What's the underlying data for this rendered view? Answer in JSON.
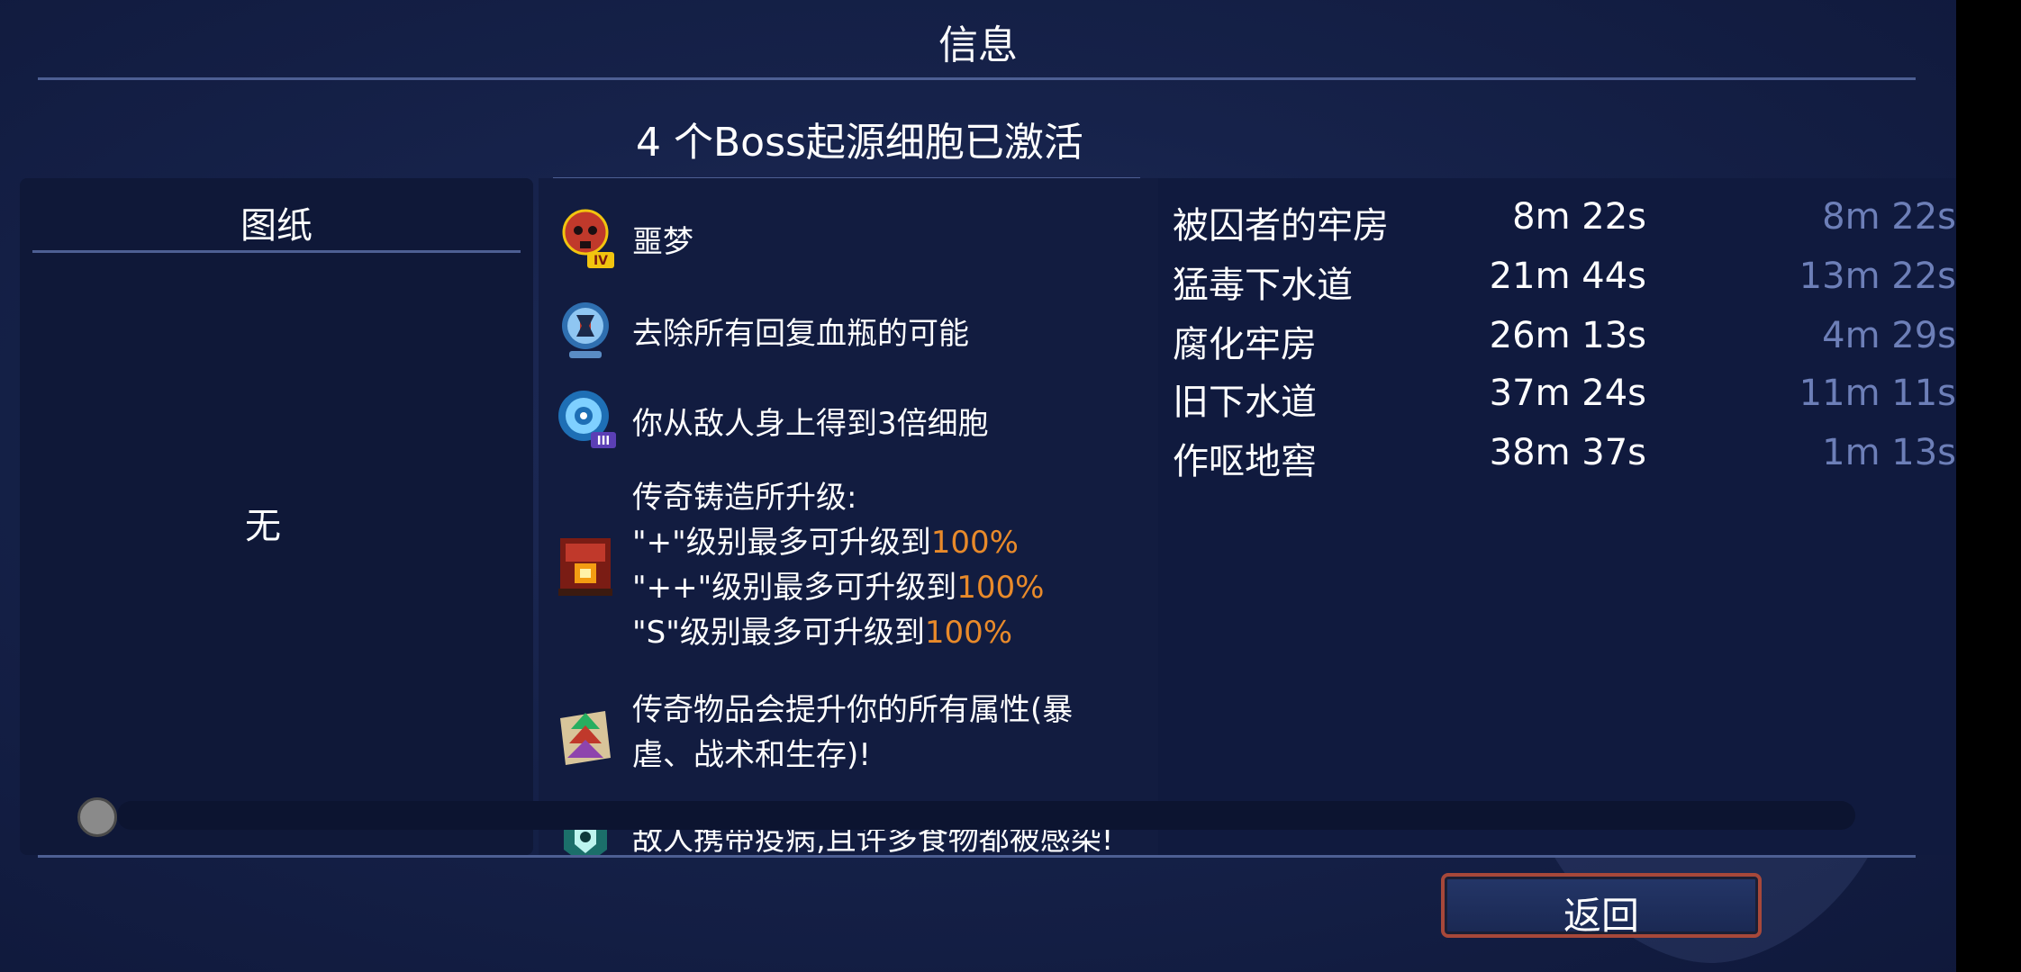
{
  "header": {
    "title": "信息"
  },
  "subtitle": "4 个Boss起源细胞已激活",
  "blueprints": {
    "heading": "图纸",
    "empty_text": "无"
  },
  "modifiers": [
    {
      "icon": "skull-iv-icon",
      "lines": [
        [
          {
            "t": "噩梦"
          }
        ]
      ]
    },
    {
      "icon": "potion-flask-icon",
      "lines": [
        [
          {
            "t": "去除所有回复血瓶的可能"
          }
        ]
      ]
    },
    {
      "icon": "cell-orb-iii-icon",
      "lines": [
        [
          {
            "t": "你从敌人身上得到3倍细胞"
          }
        ]
      ]
    },
    {
      "icon": "forge-anvil-icon",
      "lines": [
        [
          {
            "t": "传奇铸造所升级:"
          }
        ],
        [
          {
            "t": " \"+\"级别最多可升级到"
          },
          {
            "t": "100%",
            "c": "orange"
          }
        ],
        [
          {
            "t": " \"++\"级别最多可升级到"
          },
          {
            "t": "100%",
            "c": "orange"
          }
        ],
        [
          {
            "t": " \"S\"级别最多可升级到"
          },
          {
            "t": "100%",
            "c": "orange"
          }
        ]
      ]
    },
    {
      "icon": "legendary-scroll-icon",
      "lines": [
        [
          {
            "t": "传奇物品会提升你的所有属性(暴"
          }
        ],
        [
          {
            "t": "虐、战术和生存)!"
          }
        ]
      ]
    },
    {
      "icon": "malaise-icon",
      "lines": [
        [
          {
            "t": "敌人携带疫病,且许多食物都被感染!"
          }
        ]
      ]
    }
  ],
  "timings": [
    {
      "level": "被囚者的牢房",
      "time": "8m 22s",
      "diff": "8m 22s"
    },
    {
      "level": "猛毒下水道",
      "time": "21m 44s",
      "diff": "13m 22s"
    },
    {
      "level": "腐化牢房",
      "time": "26m 13s",
      "diff": "4m 29s"
    },
    {
      "level": "旧下水道",
      "time": "37m 24s",
      "diff": "11m 11s"
    },
    {
      "level": "作呕地窖",
      "time": "38m 37s",
      "diff": "1m 13s"
    }
  ],
  "footer": {
    "back_label": "返回"
  },
  "colors": {
    "accent_orange": "#e98a2a",
    "diff_blue": "#6d7fb8",
    "panel_bg": "#101a3e"
  }
}
